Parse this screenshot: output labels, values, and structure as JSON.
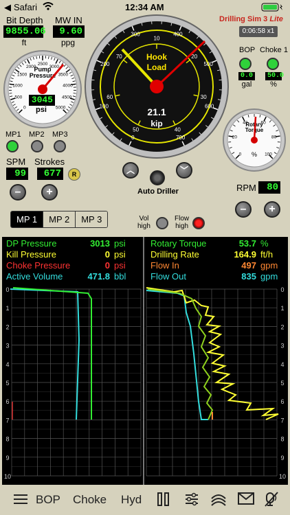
{
  "status": {
    "carrier": "Safari",
    "time": "12:34 AM"
  },
  "app": {
    "title": "Drilling Sim 3",
    "title_suffix": "Lite",
    "timer": "0:06:58 x1"
  },
  "bit_depth": {
    "label": "Bit Depth",
    "value": "9855.06",
    "unit": "ft"
  },
  "mw_in": {
    "label": "MW IN",
    "value": "9.60",
    "unit": "ppg"
  },
  "pump_gauge": {
    "title": "Pump\nPressure",
    "value": "3045",
    "unit": "psi",
    "ticks": [
      "0",
      "500",
      "1000",
      "1500",
      "2000",
      "2500",
      "3000",
      "3500",
      "4000",
      "4500",
      "5000"
    ]
  },
  "hook_gauge": {
    "title": "Hook\nLoad",
    "value": "21.1",
    "unit": "kip",
    "ticks": [
      "0",
      "100",
      "200",
      "300",
      "400",
      "500",
      "600",
      "700"
    ],
    "inner_ticks": [
      "10",
      "20",
      "30",
      "40",
      "50",
      "60",
      "70"
    ]
  },
  "rotary_gauge": {
    "title": "Rotary\nTorque",
    "unit": "%",
    "ticks": [
      "0",
      "20",
      "40",
      "60",
      "80",
      "100"
    ]
  },
  "bop": {
    "label": "BOP",
    "value": "0.0",
    "unit": "gal"
  },
  "choke1": {
    "label": "Choke 1",
    "value": "50.0",
    "unit": "%"
  },
  "pumps": {
    "mp1": "MP1",
    "mp2": "MP2",
    "mp3": "MP3"
  },
  "spm": {
    "label": "SPM",
    "value": "99"
  },
  "strokes": {
    "label": "Strokes",
    "value": "677",
    "reset": "R"
  },
  "auto_driller": {
    "label": "Auto Driller"
  },
  "rpm": {
    "label": "RPM",
    "value": "80"
  },
  "tabs": [
    "MP 1",
    "MP 2",
    "MP 3"
  ],
  "alarms": {
    "vol_high": "Vol\nhigh",
    "flow_high": "Flow\nhigh"
  },
  "left_readouts": [
    {
      "label": "DP Pressure",
      "value": "3013",
      "unit": "psi",
      "color": "#33ee33"
    },
    {
      "label": "Kill Pressure",
      "value": "0",
      "unit": "psi",
      "color": "#ffff33"
    },
    {
      "label": "Choke Pressure",
      "value": "0",
      "unit": "psi",
      "color": "#ff3333"
    },
    {
      "label": "Active Volume",
      "value": "471.8",
      "unit": "bbl",
      "color": "#33dddd"
    }
  ],
  "right_readouts": [
    {
      "label": "Rotary Torque",
      "value": "53.7",
      "unit": "%",
      "color": "#33ee33"
    },
    {
      "label": "Drilling Rate",
      "value": "164.9",
      "unit": "ft/h",
      "color": "#ffff33"
    },
    {
      "label": "Flow In",
      "value": "497",
      "unit": "gpm",
      "color": "#ff8833"
    },
    {
      "label": "Flow Out",
      "value": "835",
      "unit": "gpm",
      "color": "#33dddd"
    }
  ],
  "depth_axis": [
    "0",
    "1",
    "2",
    "3",
    "4",
    "5",
    "6",
    "7",
    "8",
    "9",
    "10"
  ],
  "toolbar": {
    "bop": "BOP",
    "choke": "Choke",
    "hyd": "Hyd"
  }
}
